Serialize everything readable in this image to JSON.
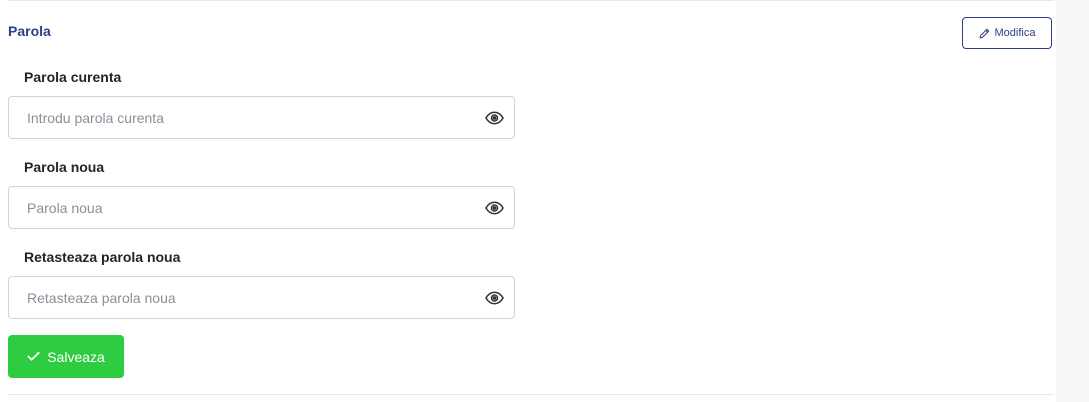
{
  "section": {
    "title": "Parola",
    "edit_button": {
      "label": "Modifica",
      "icon": "pencil-icon"
    }
  },
  "fields": [
    {
      "label": "Parola curenta",
      "placeholder": "Introdu parola curenta",
      "value": "",
      "icon": "eye-icon"
    },
    {
      "label": "Parola noua",
      "placeholder": "Parola noua",
      "value": "",
      "icon": "eye-icon"
    },
    {
      "label": "Retasteaza parola noua",
      "placeholder": "Retasteaza parola noua",
      "value": "",
      "icon": "eye-icon"
    }
  ],
  "save_button": {
    "label": "Salveaza",
    "icon": "check-icon"
  },
  "colors": {
    "accent": "#2e3d87",
    "success": "#2ecc40",
    "border": "#ced4da",
    "placeholder": "#8a9099"
  }
}
